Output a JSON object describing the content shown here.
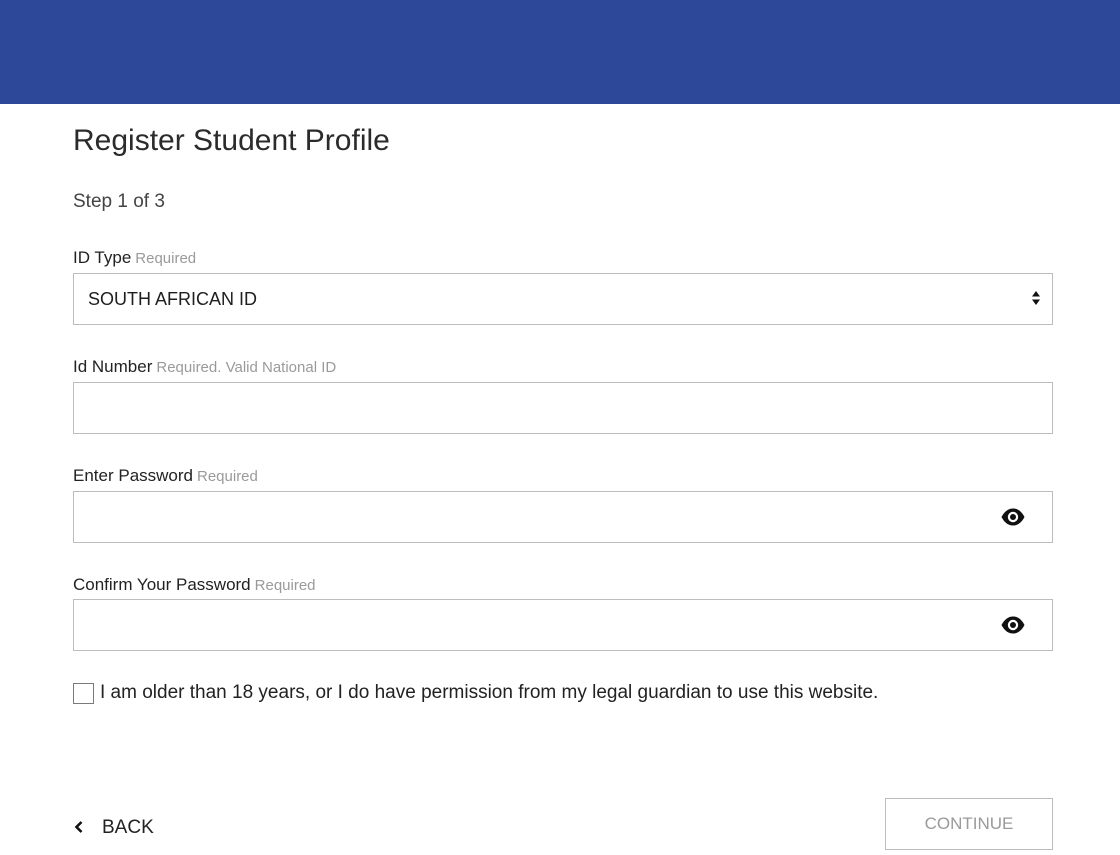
{
  "header": {
    "color": "#2d4898"
  },
  "page": {
    "title": "Register Student Profile",
    "step": "Step 1 of 3"
  },
  "form": {
    "id_type": {
      "label": "ID Type",
      "hint": "Required",
      "value": "SOUTH AFRICAN ID",
      "icon": "sort-arrows-icon"
    },
    "id_number": {
      "label": "Id Number",
      "hint": "Required. Valid National ID",
      "value": ""
    },
    "password": {
      "label": "Enter Password",
      "hint": "Required",
      "value": "",
      "icon": "eye-icon"
    },
    "confirm_password": {
      "label": "Confirm Your Password",
      "hint": "Required",
      "value": "",
      "icon": "eye-icon"
    },
    "consent": {
      "checked": false,
      "text": "I am older than 18 years, or I do have permission from my legal guardian to use this website."
    }
  },
  "actions": {
    "back_label": "BACK",
    "back_icon": "chevron-left-icon",
    "continue_label": "CONTINUE"
  }
}
